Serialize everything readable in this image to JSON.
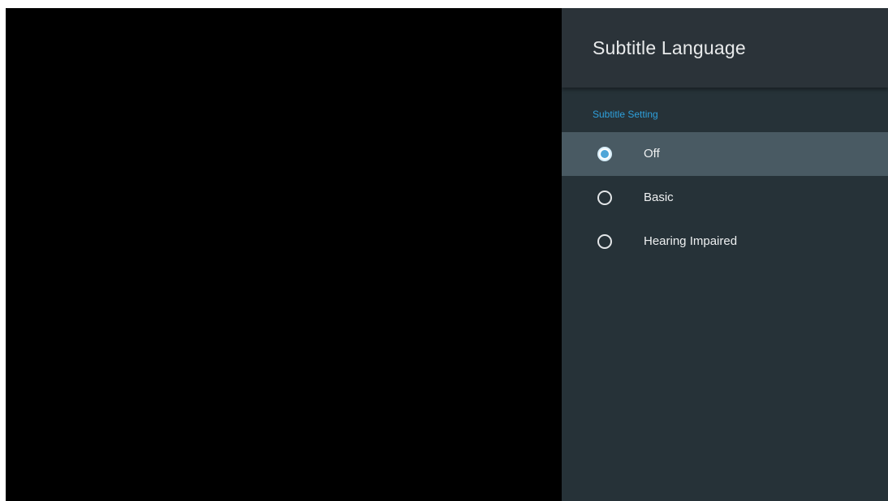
{
  "panel": {
    "title": "Subtitle Language",
    "section_label": "Subtitle Setting",
    "options": [
      {
        "label": "Off",
        "selected": true
      },
      {
        "label": "Basic",
        "selected": false
      },
      {
        "label": "Hearing Impaired",
        "selected": false
      }
    ]
  },
  "colors": {
    "background": "#000000",
    "panel": "#263238",
    "panel_header": "#2b3339",
    "highlight": "#495a63",
    "accent": "#2ea0dc",
    "radio_fill": "#4fa6d8"
  },
  "icons": {
    "radio_checked": "radio-checked-icon",
    "radio_unchecked": "radio-unchecked-icon"
  }
}
